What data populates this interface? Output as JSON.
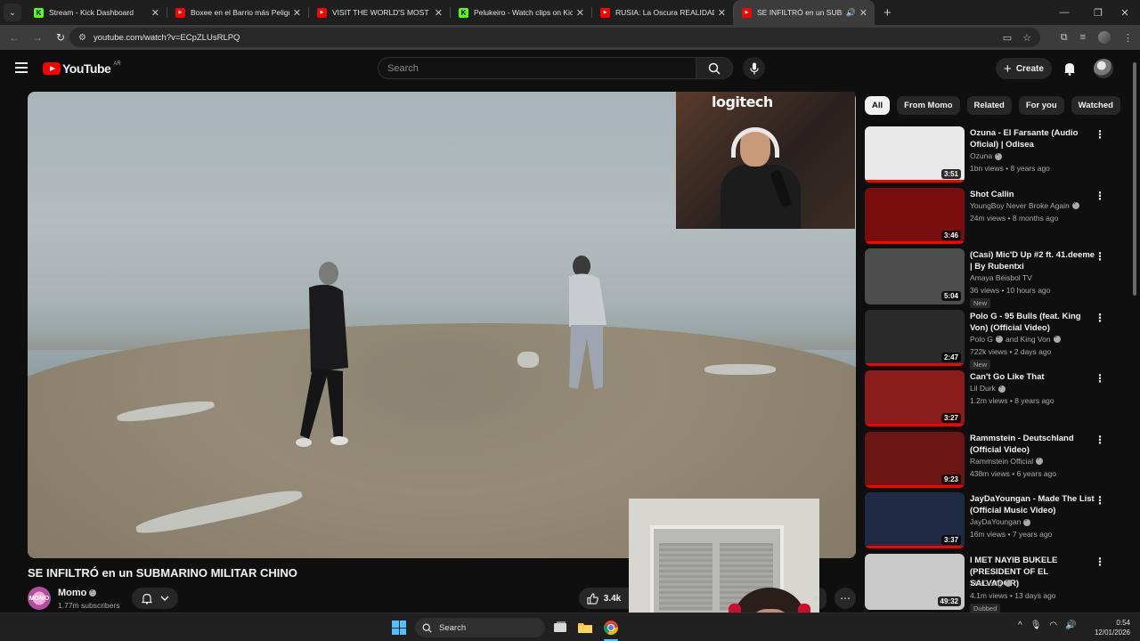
{
  "browser": {
    "tabs": [
      {
        "title": "Stream - Kick Dashboard",
        "favicon": "kick-icon",
        "active": false
      },
      {
        "title": "Boxee en el Barrio más Peligroso",
        "favicon": "youtube-icon",
        "active": false
      },
      {
        "title": "VISIT THE WORLD'S MOST HUMAN",
        "favicon": "youtube-icon",
        "active": false
      },
      {
        "title": "Pelukeiro - Watch clips on Kick",
        "favicon": "kick-icon",
        "active": false
      },
      {
        "title": "RUSIA: La Oscura REALIDAD de",
        "favicon": "youtube-icon",
        "active": false
      },
      {
        "title": "SE INFILTRÓ en un SUBMARINO",
        "favicon": "youtube-icon",
        "active": true
      }
    ],
    "new_tab": "+",
    "url": "youtube.com/watch?v=ECpZLUsRLPQ"
  },
  "youtube": {
    "logo_text": "YouTube",
    "region": "AR",
    "search_placeholder": "Search",
    "create_label": "Create",
    "video": {
      "title": "SE INFILTRÓ en un SUBMARINO MILITAR CHINO",
      "webcam_sign": "logitech",
      "channel": "Momo",
      "channel_avatar_text": "MOMO",
      "subscribers": "1.77m subscribers",
      "likes": "3.4k",
      "share_fragment": "e"
    },
    "chips": [
      "All",
      "From Momo",
      "Related",
      "For you",
      "Watched"
    ],
    "recommendations": [
      {
        "title": "Ozuna - El Farsante (Audio Oficial) | Odisea",
        "channel": "Ozuna",
        "verified": true,
        "meta": "1bn views • 8 years ago",
        "duration": "3:51",
        "badge": "",
        "thumb_bg": "#e9e9e9",
        "watched": 1.0
      },
      {
        "title": "Shot Callin",
        "channel": "YoungBoy Never Broke Again",
        "verified": true,
        "meta": "24m views • 8 months ago",
        "duration": "3:46",
        "badge": "",
        "thumb_bg": "#7a0d0d",
        "watched": 1.0
      },
      {
        "title": "(Casi) Mic'D Up #2 ft. 41.deeme | By Rubentxi",
        "channel": "Amaya Béisbol TV",
        "verified": false,
        "meta": "36 views • 10 hours ago",
        "duration": "5:04",
        "badge": "New",
        "thumb_bg": "#4d4d4d",
        "watched": 0
      },
      {
        "title": "Polo G - 95 Bulls (feat. King Von) (Official Video)",
        "channel": "Polo G",
        "channel_extra": "and King Von",
        "verified": true,
        "meta": "722k views • 2 days ago",
        "duration": "2:47",
        "badge": "New",
        "thumb_bg": "#2b2b2b",
        "watched": 1.0
      },
      {
        "title": "Can't Go Like That",
        "channel": "Lil Durk",
        "verified": true,
        "meta": "1.2m views • 8 years ago",
        "duration": "3:27",
        "badge": "",
        "thumb_bg": "#8a1c1c",
        "watched": 1.0
      },
      {
        "title": "Rammstein - Deutschland (Official Video)",
        "channel": "Rammstein Official",
        "verified": true,
        "meta": "438m views • 6 years ago",
        "duration": "9:23",
        "badge": "",
        "thumb_bg": "#6b1515",
        "watched": 1.0
      },
      {
        "title": "JayDaYoungan - Made The List (Official Music Video)",
        "channel": "JayDaYoungan",
        "verified": true,
        "meta": "16m views • 7 years ago",
        "duration": "3:37",
        "badge": "",
        "thumb_bg": "#1f2a44",
        "watched": 1.0
      },
      {
        "title": "I MET NAYIB BUKELE (PRESIDENT OF EL SALVADOR)",
        "channel": "TheGrefg",
        "verified": true,
        "meta": "4.1m views • 13 days ago",
        "duration": "49:32",
        "badge": "Dubbed",
        "thumb_bg": "#c9c9c9",
        "watched": 0
      }
    ]
  },
  "taskbar": {
    "search_label": "Search",
    "time": "0:54",
    "date": "12/01/2026"
  },
  "colors": {
    "yt_red": "#ff0000",
    "kick_green": "#53fc18",
    "background": "#0f0f0f",
    "chip_bg": "#272727"
  }
}
